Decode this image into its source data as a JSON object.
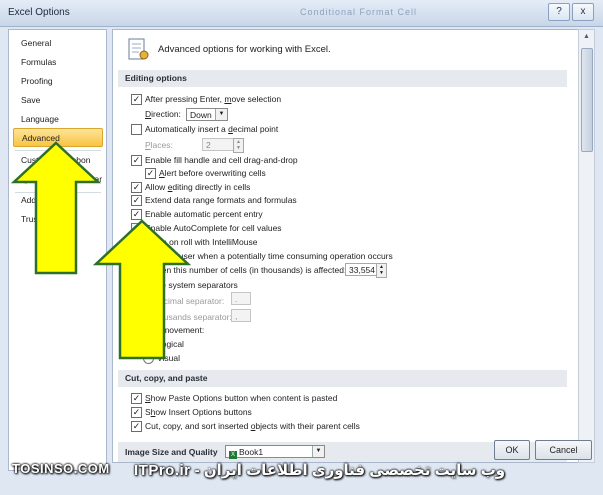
{
  "window": {
    "title": "Excel Options",
    "ghost_text": "Conditional   Format   Cell",
    "help_button": "?",
    "close_button": "x"
  },
  "nav": {
    "items": [
      {
        "label": "General"
      },
      {
        "label": "Formulas"
      },
      {
        "label": "Proofing"
      },
      {
        "label": "Save"
      },
      {
        "label": "Language"
      },
      {
        "label": "Advanced"
      },
      {
        "label": "Customize Ribbon"
      },
      {
        "label": "Quick Access Toolbar"
      },
      {
        "label": "Add-Ins"
      },
      {
        "label": "Trust Center"
      }
    ],
    "selected": "Advanced"
  },
  "content": {
    "header": "Advanced options for working with Excel.",
    "sections": {
      "editing": "Editing options",
      "cut": "Cut, copy, and paste",
      "image": "Image Size and Quality"
    },
    "editing": {
      "after_enter": {
        "pre": "After pressing Enter, ",
        "u": "m",
        "post": "ove selection",
        "checked": true
      },
      "direction_label": {
        "pre": "",
        "u": "D",
        "post": "irection:"
      },
      "direction_value": "Down",
      "auto_decimal": {
        "pre": "Automatically insert a ",
        "u": "d",
        "post": "ecimal point",
        "checked": false
      },
      "places_label": {
        "pre": "",
        "u": "P",
        "post": "laces:"
      },
      "places_value": "2",
      "fill_handle": {
        "pre": "Enable fill handle and cell drag-and-drop",
        "checked": true
      },
      "alert_overwrite": {
        "pre": "",
        "u": "A",
        "post": "lert before overwriting cells",
        "checked": true
      },
      "edit_directly": {
        "pre": "Allow ",
        "u": "e",
        "post": "diting directly in cells",
        "checked": true
      },
      "extend_formats": {
        "pre": "Extend data range formats and formulas",
        "checked": true
      },
      "percent_entry": {
        "pre": "Enable automatic percent entry",
        "checked": true
      },
      "autocomplete": {
        "pre": "Enable AutoComplete for cell values",
        "checked": false
      },
      "zoom_roll": {
        "pre": "Zoom on roll with IntelliMouse"
      },
      "alert_time": {
        "pre": "rt the user when a potentially time consuming operation occurs"
      },
      "when_number": {
        "pre": "hen this number of cells (in thousands) is affected:"
      },
      "cells_value": "33,554",
      "use_sep": {
        "pre": "se system separators"
      },
      "decimal_sep": {
        "pre": "ecimal separator:"
      },
      "decimal_value": ".",
      "thousands_sep": {
        "pre": "ousands separator:"
      },
      "thousands_value": ",",
      "cursor_movement": {
        "pre": "r movement:"
      },
      "logical": {
        "pre": "Logical"
      },
      "visual": {
        "pre": "Visual"
      }
    },
    "cut": {
      "paste_options": {
        "pre": "",
        "u": "S",
        "post": "how Paste Options button when content is pasted",
        "checked": true
      },
      "insert_options": {
        "pre": "S",
        "u": "h",
        "post": "ow Insert Options buttons",
        "checked": true
      },
      "sort_objects": {
        "pre": "Cut, copy, and sort inserted ",
        "u": "o",
        "post": "bjects with their parent cells",
        "checked": true
      }
    },
    "image": {
      "workbook": "Book1"
    }
  },
  "buttons": {
    "ok": "OK",
    "cancel": "Cancel"
  },
  "watermark": {
    "left": "TOSINSO.COM",
    "right": "وب سایت تخصصی فناوری اطلاعات ایران - ITPro.ir"
  },
  "colors": {
    "arrow_fill": "#ffff00",
    "arrow_stroke": "#2e6f2a",
    "selected_nav": "#f9c441"
  }
}
